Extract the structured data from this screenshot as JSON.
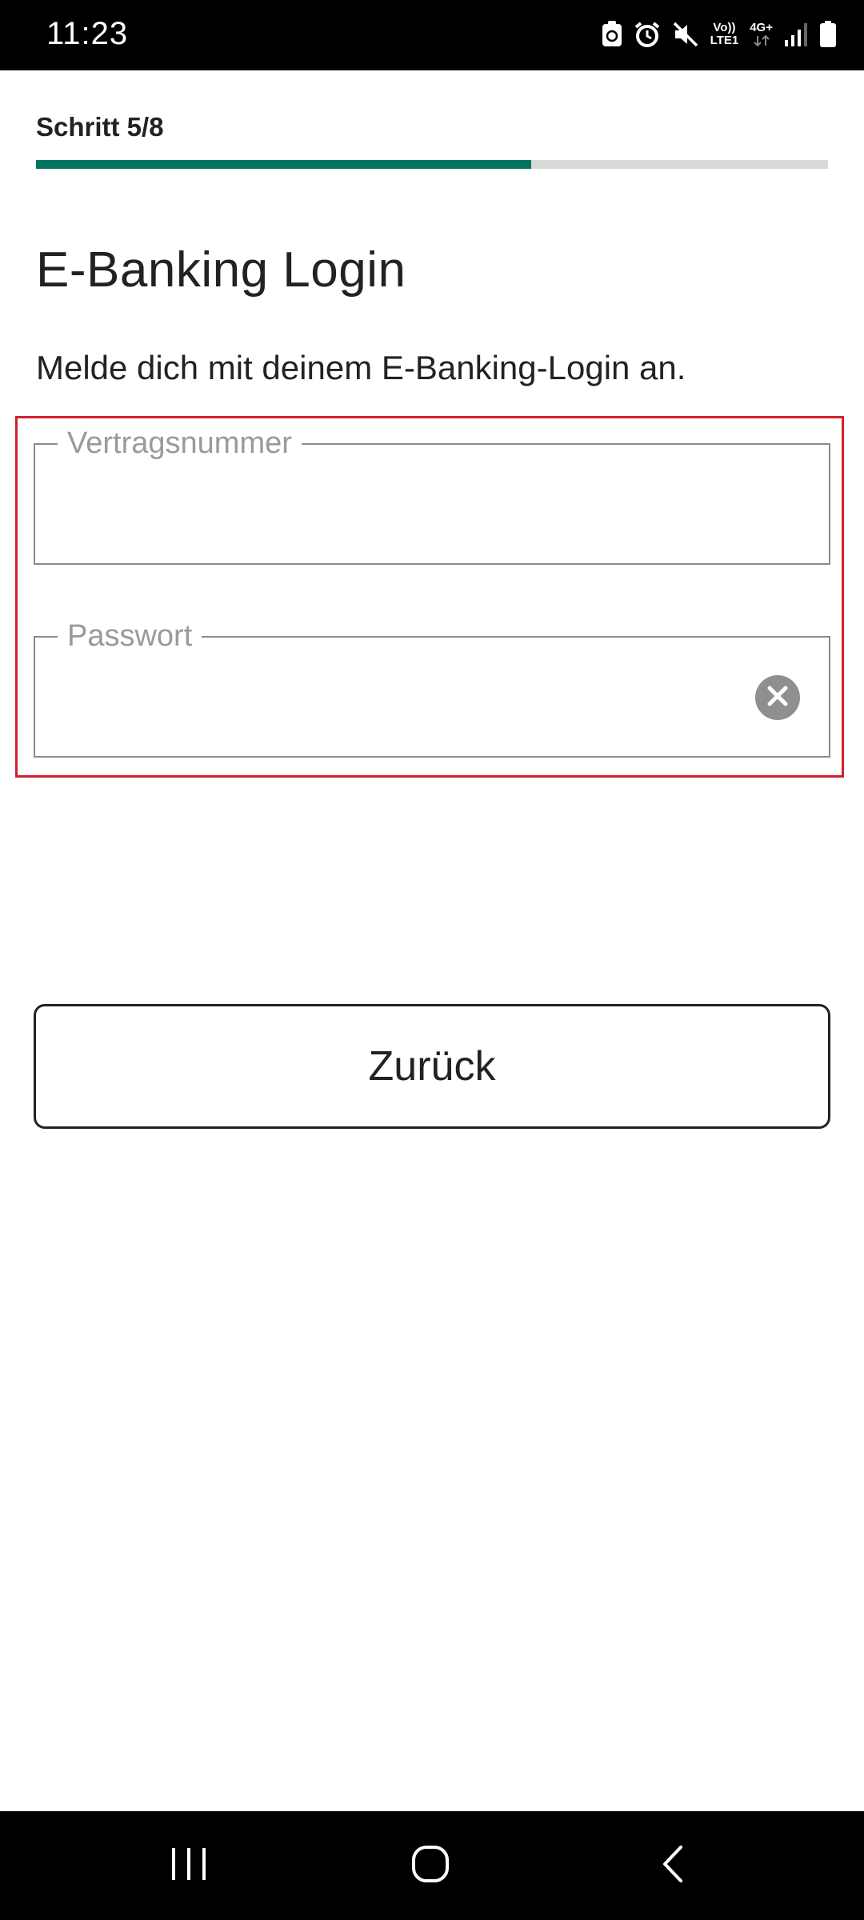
{
  "status_bar": {
    "time": "11:23",
    "icons": [
      "sync-icon",
      "alarm-icon",
      "mute-icon",
      "volte-icon",
      "network-4g-icon",
      "signal-icon",
      "battery-icon"
    ],
    "volte_label_top": "Vo))",
    "volte_label_bottom": "LTE1",
    "network_label": "4G+"
  },
  "step": {
    "label": "Schritt 5/8",
    "current": 5,
    "total": 8,
    "progress_fraction": 0.625,
    "progress_color": "#00745f"
  },
  "title": "E-Banking Login",
  "subtitle": "Melde dich mit deinem E-Banking-Login an.",
  "form": {
    "contract_number": {
      "label": "Vertragsnummer",
      "value": ""
    },
    "password": {
      "label": "Passwort",
      "value": "",
      "clear_icon": "clear-circle-icon"
    },
    "highlight_color": "#d1222e"
  },
  "buttons": {
    "back_label": "Zurück"
  },
  "nav_bar": {
    "items": [
      "recents-icon",
      "home-icon",
      "back-icon"
    ]
  }
}
